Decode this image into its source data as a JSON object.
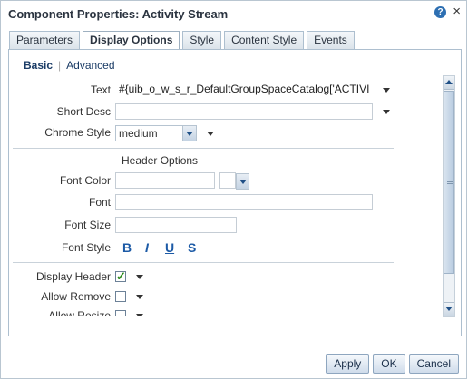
{
  "dialog": {
    "title": "Component Properties: Activity Stream",
    "help_icon": "?",
    "close_icon": "×"
  },
  "tabs": [
    {
      "label": "Parameters",
      "active": false
    },
    {
      "label": "Display Options",
      "active": true
    },
    {
      "label": "Style",
      "active": false
    },
    {
      "label": "Content Style",
      "active": false
    },
    {
      "label": "Events",
      "active": false
    }
  ],
  "subnav": {
    "basic": "Basic",
    "advanced": "Advanced"
  },
  "form": {
    "text_label": "Text",
    "text_value": "#{uib_o_w_s_r_DefaultGroupSpaceCatalog['ACTIVI",
    "short_desc_label": "Short Desc",
    "short_desc_value": "",
    "chrome_style_label": "Chrome Style",
    "chrome_style_value": "medium",
    "header_options_label": "Header Options",
    "font_color_label": "Font Color",
    "font_color_value": "",
    "font_label": "Font",
    "font_value": "",
    "font_size_label": "Font Size",
    "font_size_value": "",
    "font_style_label": "Font Style",
    "font_style_buttons": {
      "bold": "B",
      "italic": "I",
      "underline": "U",
      "strike": "S"
    },
    "display_header_label": "Display Header",
    "display_header_checked": true,
    "allow_remove_label": "Allow Remove",
    "allow_remove_checked": false,
    "allow_resize_label": "Allow Resize",
    "allow_resize_checked": false
  },
  "buttons": {
    "apply": "Apply",
    "ok": "OK",
    "cancel": "Cancel"
  },
  "colors": {
    "accent": "#1c5aa6",
    "title": "#2b3440",
    "border": "#adbfcf"
  }
}
